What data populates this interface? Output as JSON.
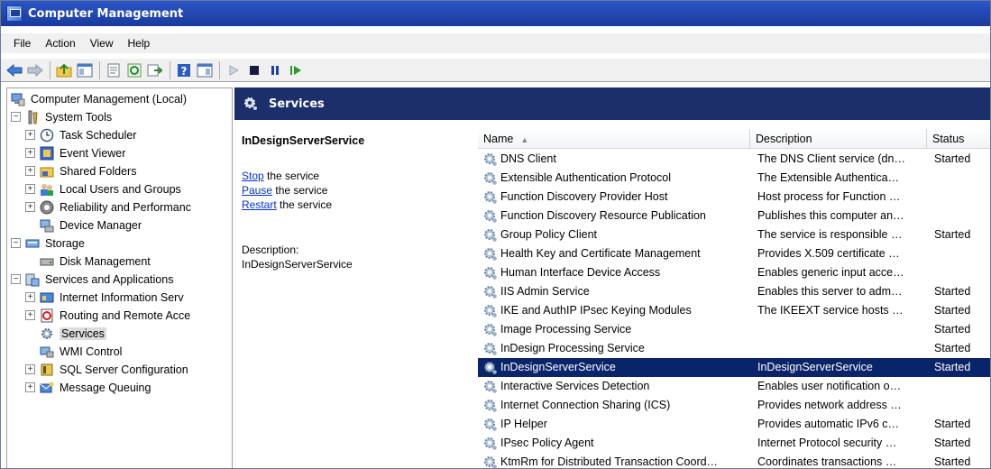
{
  "window": {
    "title": "Computer Management"
  },
  "menu": [
    "File",
    "Action",
    "View",
    "Help"
  ],
  "toolbar": {
    "buttons": [
      "back-icon",
      "forward-icon",
      "up-folder-icon",
      "show-hide-tree-icon",
      "properties-icon",
      "refresh-icon",
      "export-list-icon",
      "help-icon",
      "show-hide-action-pane-icon",
      "start-icon",
      "stop-icon",
      "pause-icon",
      "resume-icon"
    ]
  },
  "tree": {
    "items": [
      {
        "label": "Computer Management (Local)",
        "level": 0,
        "toggle": "",
        "icon": "computer-management-icon"
      },
      {
        "label": "System Tools",
        "level": 1,
        "toggle": "−",
        "icon": "system-tools-icon"
      },
      {
        "label": "Task Scheduler",
        "level": 2,
        "toggle": "+",
        "icon": "clock-icon"
      },
      {
        "label": "Event Viewer",
        "level": 2,
        "toggle": "+",
        "icon": "event-viewer-icon"
      },
      {
        "label": "Shared Folders",
        "level": 2,
        "toggle": "+",
        "icon": "shared-folder-icon"
      },
      {
        "label": "Local Users and Groups",
        "level": 2,
        "toggle": "+",
        "icon": "users-icon"
      },
      {
        "label": "Reliability and Performanc",
        "level": 2,
        "toggle": "+",
        "icon": "performance-icon"
      },
      {
        "label": "Device Manager",
        "level": 2,
        "toggle": "",
        "icon": "device-manager-icon"
      },
      {
        "label": "Storage",
        "level": 1,
        "toggle": "−",
        "icon": "storage-icon"
      },
      {
        "label": "Disk Management",
        "level": 2,
        "toggle": "",
        "icon": "disk-icon"
      },
      {
        "label": "Services and Applications",
        "level": 1,
        "toggle": "−",
        "icon": "services-applications-icon"
      },
      {
        "label": "Internet Information Serv",
        "level": 2,
        "toggle": "+",
        "icon": "iis-icon"
      },
      {
        "label": "Routing and Remote Acce",
        "level": 2,
        "toggle": "+",
        "icon": "routing-icon"
      },
      {
        "label": "Services",
        "level": 2,
        "toggle": "",
        "icon": "services-icon",
        "selected": true
      },
      {
        "label": "WMI Control",
        "level": 2,
        "toggle": "",
        "icon": "wmi-icon"
      },
      {
        "label": "SQL Server Configuration",
        "level": 2,
        "toggle": "+",
        "icon": "sql-server-icon"
      },
      {
        "label": "Message Queuing",
        "level": 2,
        "toggle": "+",
        "icon": "message-queue-icon"
      }
    ]
  },
  "pane": {
    "header": "Services",
    "selected_service": "InDesignServerService",
    "actions": [
      {
        "link": "Stop",
        "text": " the service"
      },
      {
        "link": "Pause",
        "text": " the service"
      },
      {
        "link": "Restart",
        "text": " the service"
      }
    ],
    "description_label": "Description:",
    "description_value": "InDesignServerService"
  },
  "grid": {
    "columns": {
      "name": "Name",
      "description": "Description",
      "status": "Status"
    },
    "rows": [
      {
        "name": "DNS Client",
        "description": "The DNS Client service (dn…",
        "status": "Started"
      },
      {
        "name": "Extensible Authentication Protocol",
        "description": "The Extensible Authentica…",
        "status": ""
      },
      {
        "name": "Function Discovery Provider Host",
        "description": "Host process for Function …",
        "status": ""
      },
      {
        "name": "Function Discovery Resource Publication",
        "description": "Publishes this computer an…",
        "status": ""
      },
      {
        "name": "Group Policy Client",
        "description": "The service is responsible …",
        "status": "Started"
      },
      {
        "name": "Health Key and Certificate Management",
        "description": "Provides X.509 certificate …",
        "status": ""
      },
      {
        "name": "Human Interface Device Access",
        "description": "Enables generic input acce…",
        "status": ""
      },
      {
        "name": "IIS Admin Service",
        "description": "Enables this server to adm…",
        "status": "Started"
      },
      {
        "name": "IKE and AuthIP IPsec Keying Modules",
        "description": "The IKEEXT service hosts …",
        "status": "Started"
      },
      {
        "name": "Image Processing Service",
        "description": "",
        "status": "Started"
      },
      {
        "name": "InDesign Processing Service",
        "description": "",
        "status": "Started"
      },
      {
        "name": "InDesignServerService",
        "description": "InDesignServerService",
        "status": "Started",
        "selected": true
      },
      {
        "name": "Interactive Services Detection",
        "description": "Enables user notification o…",
        "status": ""
      },
      {
        "name": "Internet Connection Sharing (ICS)",
        "description": "Provides network address …",
        "status": ""
      },
      {
        "name": "IP Helper",
        "description": "Provides automatic IPv6 c…",
        "status": "Started"
      },
      {
        "name": "IPsec Policy Agent",
        "description": "Internet Protocol security …",
        "status": "Started"
      },
      {
        "name": "KtmRm for Distributed Transaction Coord…",
        "description": "Coordinates transactions …",
        "status": "Started"
      }
    ]
  },
  "colors": {
    "title_bar": "#1f45b3",
    "pane_header": "#1c2f6b",
    "selection": "#0a246a",
    "link": "#0033cc"
  }
}
